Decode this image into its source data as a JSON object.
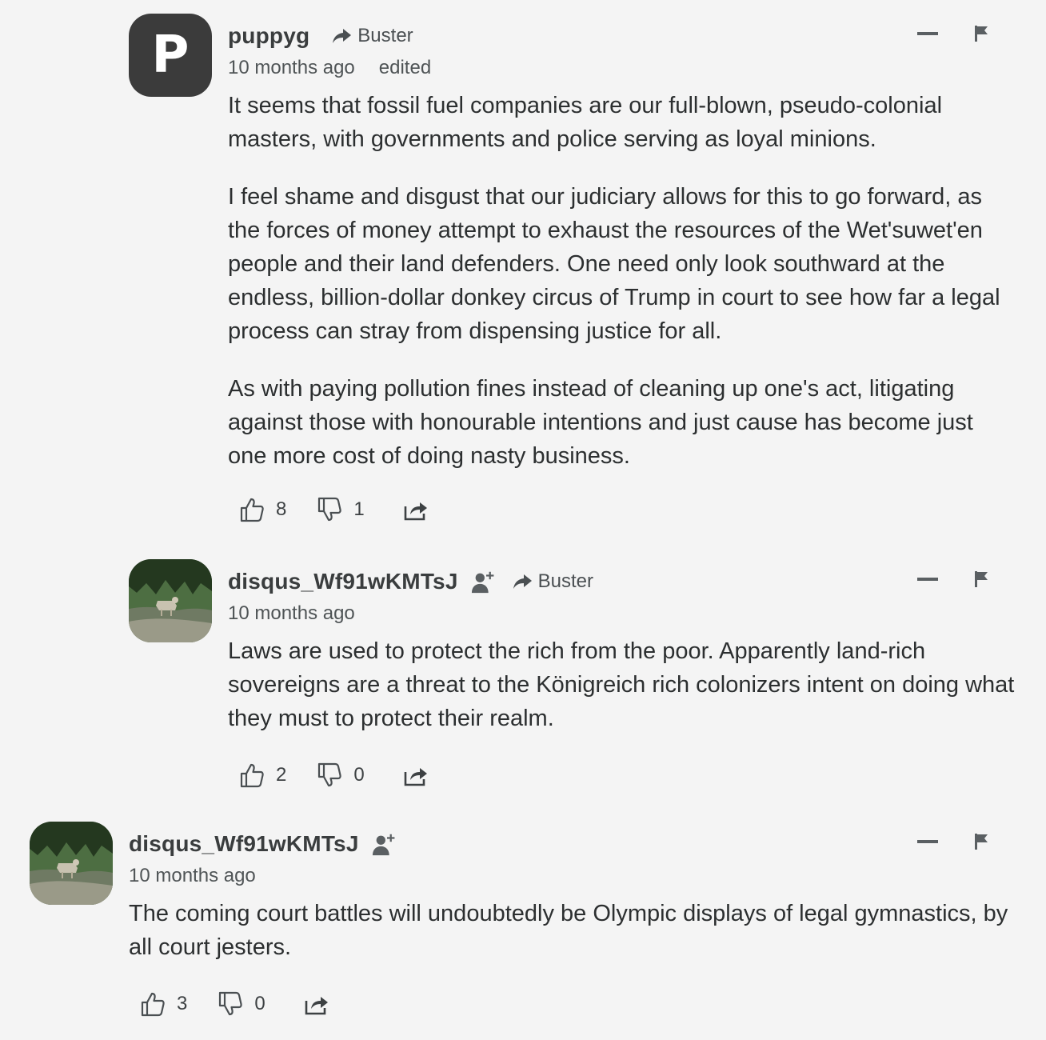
{
  "comments": [
    {
      "author": "puppyg",
      "avatar_letter": "P",
      "reply_to": "Buster",
      "time": "10 months ago",
      "edited": "edited",
      "paragraphs": [
        "It seems that fossil fuel companies are our full-blown, pseudo-colonial masters, with governments and police serving as loyal minions.",
        "I feel shame and disgust that our judiciary allows for this to go forward, as the forces of money attempt to exhaust the resources of the Wet'suwet'en people and their land defenders. One need only look southward at the endless, billion-dollar donkey circus of Trump in court to see how far a legal process can stray from dispensing justice for all.",
        "As with paying pollution fines instead of cleaning up one's act, litigating against those with honourable intentions and just cause has become just one more cost of doing nasty business."
      ],
      "upvotes": "8",
      "downvotes": "1"
    },
    {
      "author": "disqus_Wf91wKMTsJ",
      "reply_to": "Buster",
      "time": "10 months ago",
      "paragraphs": [
        "Laws are used to protect the rich from the poor. Apparently land-rich sovereigns are a threat to the Königreich rich colonizers intent on doing what they must to protect their realm."
      ],
      "upvotes": "2",
      "downvotes": "0"
    },
    {
      "author": "disqus_Wf91wKMTsJ",
      "time": "10 months ago",
      "paragraphs": [
        "The coming court battles will undoubtedly be Olympic displays of legal gymnastics, by all court jesters."
      ],
      "upvotes": "3",
      "downvotes": "0"
    }
  ],
  "icons": {
    "reply_arrow": "reply-arrow-icon",
    "follow": "follow-user-icon",
    "collapse": "collapse-icon",
    "flag": "flag-icon",
    "upvote": "thumbs-up-icon",
    "downvote": "thumbs-down-icon",
    "share": "share-icon"
  },
  "colors": {
    "background": "#f4f4f4",
    "avatar_letter_bg": "#3b3b3b",
    "text": "#2c2f30",
    "muted": "#4f5456"
  }
}
